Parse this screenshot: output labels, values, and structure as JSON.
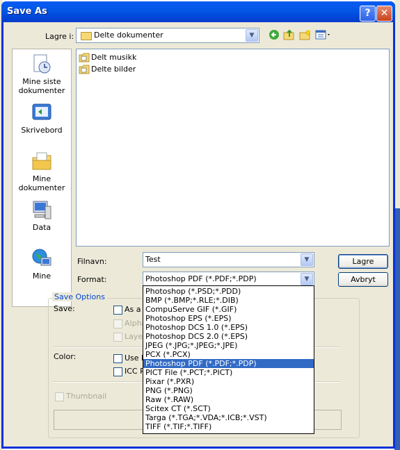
{
  "window": {
    "title": "Save As"
  },
  "lookin": {
    "label": "Lagre i:",
    "value": "Delte dokumenter"
  },
  "places": [
    {
      "label": "Mine siste dokumenter"
    },
    {
      "label": "Skrivebord"
    },
    {
      "label": "Mine dokumenter"
    },
    {
      "label": "Data"
    },
    {
      "label": "Mine"
    }
  ],
  "files": [
    {
      "name": "Delt musikk"
    },
    {
      "name": "Delte bilder"
    }
  ],
  "filename": {
    "label": "Filnavn:",
    "value": "Test"
  },
  "format": {
    "label": "Format:",
    "value": "Photoshop PDF (*.PDF;*.PDP)",
    "options": [
      "Photoshop (*.PSD;*.PDD)",
      "BMP (*.BMP;*.RLE;*.DIB)",
      "CompuServe GIF (*.GIF)",
      "Photoshop EPS (*.EPS)",
      "Photoshop DCS 1.0 (*.EPS)",
      "Photoshop DCS 2.0 (*.EPS)",
      "JPEG (*.JPG;*.JPEG;*.JPE)",
      "PCX (*.PCX)",
      "Photoshop PDF (*.PDF;*.PDP)",
      "PICT File (*.PCT;*.PICT)",
      "Pixar (*.PXR)",
      "PNG (*.PNG)",
      "Raw (*.RAW)",
      "Scitex CT (*.SCT)",
      "Targa (*.TGA;*.VDA;*.ICB;*.VST)",
      "TIFF (*.TIF;*.TIFF)"
    ],
    "selected_index": 8
  },
  "buttons": {
    "save": "Lagre",
    "cancel": "Avbryt"
  },
  "options": {
    "title": "Save Options",
    "save_label": "Save:",
    "as_a_copy": "As a C",
    "alpha": "Alpha",
    "layers": "Layer",
    "color_label": "Color:",
    "use_proof": "Use P",
    "icc": "ICC P",
    "thumbnail": "Thumbnail"
  },
  "colors": {
    "titlebar": "#0054e3",
    "selection": "#316ac5",
    "group_title": "#0046d5"
  }
}
